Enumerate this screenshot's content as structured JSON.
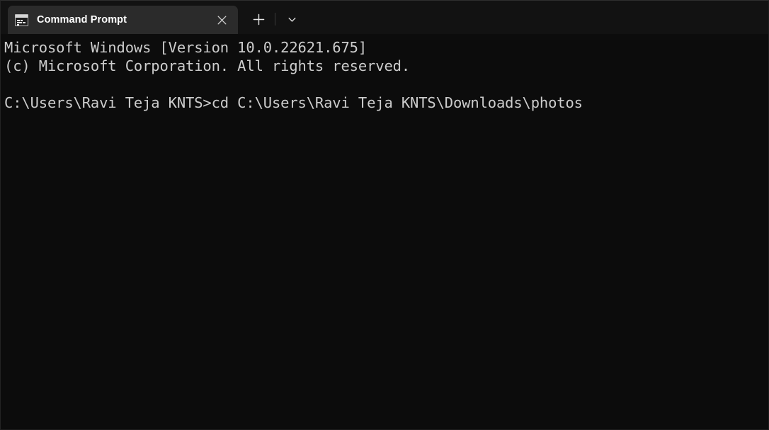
{
  "window": {
    "title": "Command Prompt",
    "background_color": "#0c0c0c",
    "tabstrip_color": "#121212",
    "active_tab_color": "#2b2b2b",
    "text_color": "#cccccc"
  },
  "tabstrip": {
    "tabs": [
      {
        "label": "Command Prompt",
        "icon": "console-icon",
        "close_label": "×",
        "active": true
      }
    ],
    "new_tab_label": "+",
    "dropdown_label": "⌄"
  },
  "terminal": {
    "lines": [
      "Microsoft Windows [Version 10.0.22621.675]",
      "(c) Microsoft Corporation. All rights reserved.",
      "",
      "C:\\Users\\Ravi Teja KNTS>cd C:\\Users\\Ravi Teja KNTS\\Downloads\\photos"
    ],
    "content": "Microsoft Windows [Version 10.0.22621.675]\n(c) Microsoft Corporation. All rights reserved.\n\nC:\\Users\\Ravi Teja KNTS>cd C:\\Users\\Ravi Teja KNTS\\Downloads\\photos",
    "prompt": "C:\\Users\\Ravi Teja KNTS>",
    "command": "cd C:\\Users\\Ravi Teja KNTS\\Downloads\\photos",
    "os_name": "Microsoft Windows",
    "os_version": "10.0.22621.675",
    "copyright": "(c) Microsoft Corporation. All rights reserved."
  }
}
